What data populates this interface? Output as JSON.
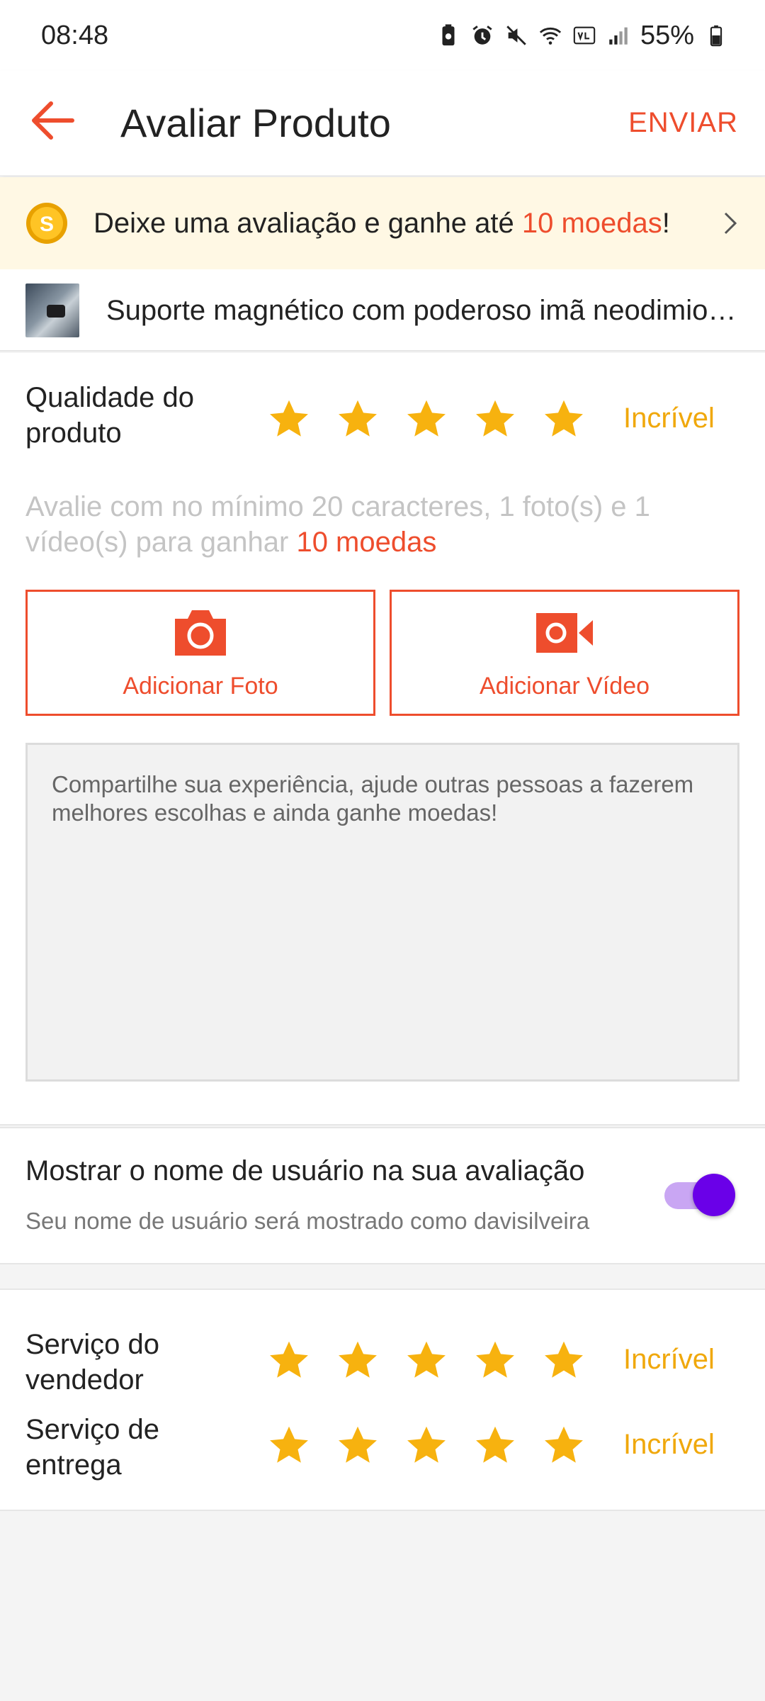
{
  "status_bar": {
    "time": "08:48",
    "battery": "55%"
  },
  "header": {
    "title": "Avaliar Produto",
    "submit_label": "ENVIAR"
  },
  "promo": {
    "text_before": "Deixe uma avaliação e ganhe até ",
    "highlight": "10 moedas",
    "text_after": "!"
  },
  "product": {
    "name": "Suporte magnético com poderoso imã neodimio para celular"
  },
  "product_quality": {
    "label": "Qualidade do produto",
    "stars": 5,
    "rating_word": "Incrível"
  },
  "hint": {
    "text": "Avalie com no mínimo 20 caracteres, 1 foto(s) e 1 vídeo(s) para ganhar ",
    "highlight": "10 moedas"
  },
  "media": {
    "photo_label": "Adicionar Foto",
    "video_label": "Adicionar Vídeo"
  },
  "review_input": {
    "placeholder": "Compartilhe sua experiência, ajude outras pessoas a fazerem melhores escolhas e ainda ganhe moedas!"
  },
  "username": {
    "title": "Mostrar o nome de usuário na sua avaliação",
    "subtitle": "Seu nome de usuário será mostrado como davisilveira",
    "toggle_on": true
  },
  "seller_service": {
    "label": "Serviço do vendedor",
    "stars": 5,
    "rating_word": "Incrível"
  },
  "delivery_service": {
    "label": "Serviço de entrega",
    "stars": 5,
    "rating_word": "Incrível"
  },
  "colors": {
    "accent": "#ee4d2d",
    "star": "#f7b20f",
    "rating_word": "#f0a80c",
    "toggle": "#6a00e8"
  }
}
